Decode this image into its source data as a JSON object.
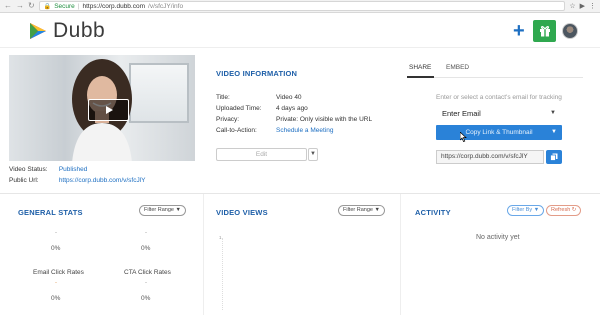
{
  "browser": {
    "secure_label": "Secure",
    "url_host": "https://corp.dubb.com",
    "url_path": "/v/sfcJY/info"
  },
  "app": {
    "logo_text": "Dubb",
    "plus_label": "+"
  },
  "video": {
    "status_label": "Video Status:",
    "status_value": "Published",
    "public_url_label": "Public Url:",
    "public_url_value": "https://corp.dubb.com/v/sfcJlY"
  },
  "info": {
    "title": "VIDEO INFORMATION",
    "rows": [
      {
        "key": "Title:",
        "value": "Video 40"
      },
      {
        "key": "Uploaded Time:",
        "value": "4 days ago"
      },
      {
        "key": "Privacy:",
        "value": "Private: Only visible with the URL"
      },
      {
        "key": "Call-to-Action:",
        "value": "Schedule a Meeting"
      }
    ],
    "edit_label": "Edit"
  },
  "share": {
    "tabs": [
      "SHARE",
      "EMBED"
    ],
    "hint": "Enter or select a contact's email for tracking",
    "email_value": "Enter Email",
    "copy_button_label": "Copy Link & Thumbnail",
    "share_url": "https://corp.dubb.com/v/sfcJlY"
  },
  "stats": {
    "general_title": "GENERAL STATS",
    "views_title": "VIDEO VIEWS",
    "activity_title": "ACTIVITY",
    "filter_label": "Filter Range",
    "filter_by_label": "Filter By",
    "refresh_label": "Refresh",
    "dash": "-",
    "zero_percent": "0%",
    "email_click_label": "Email Click Rates",
    "cta_click_label": "CTA Click Rates",
    "axis_tick": "1",
    "no_activity": "No activity yet"
  },
  "colors": {
    "accent": "#1e6fc2",
    "button_blue": "#2a82d8",
    "gift_green": "#2fa84f",
    "section_title": "#1e5fa8"
  }
}
